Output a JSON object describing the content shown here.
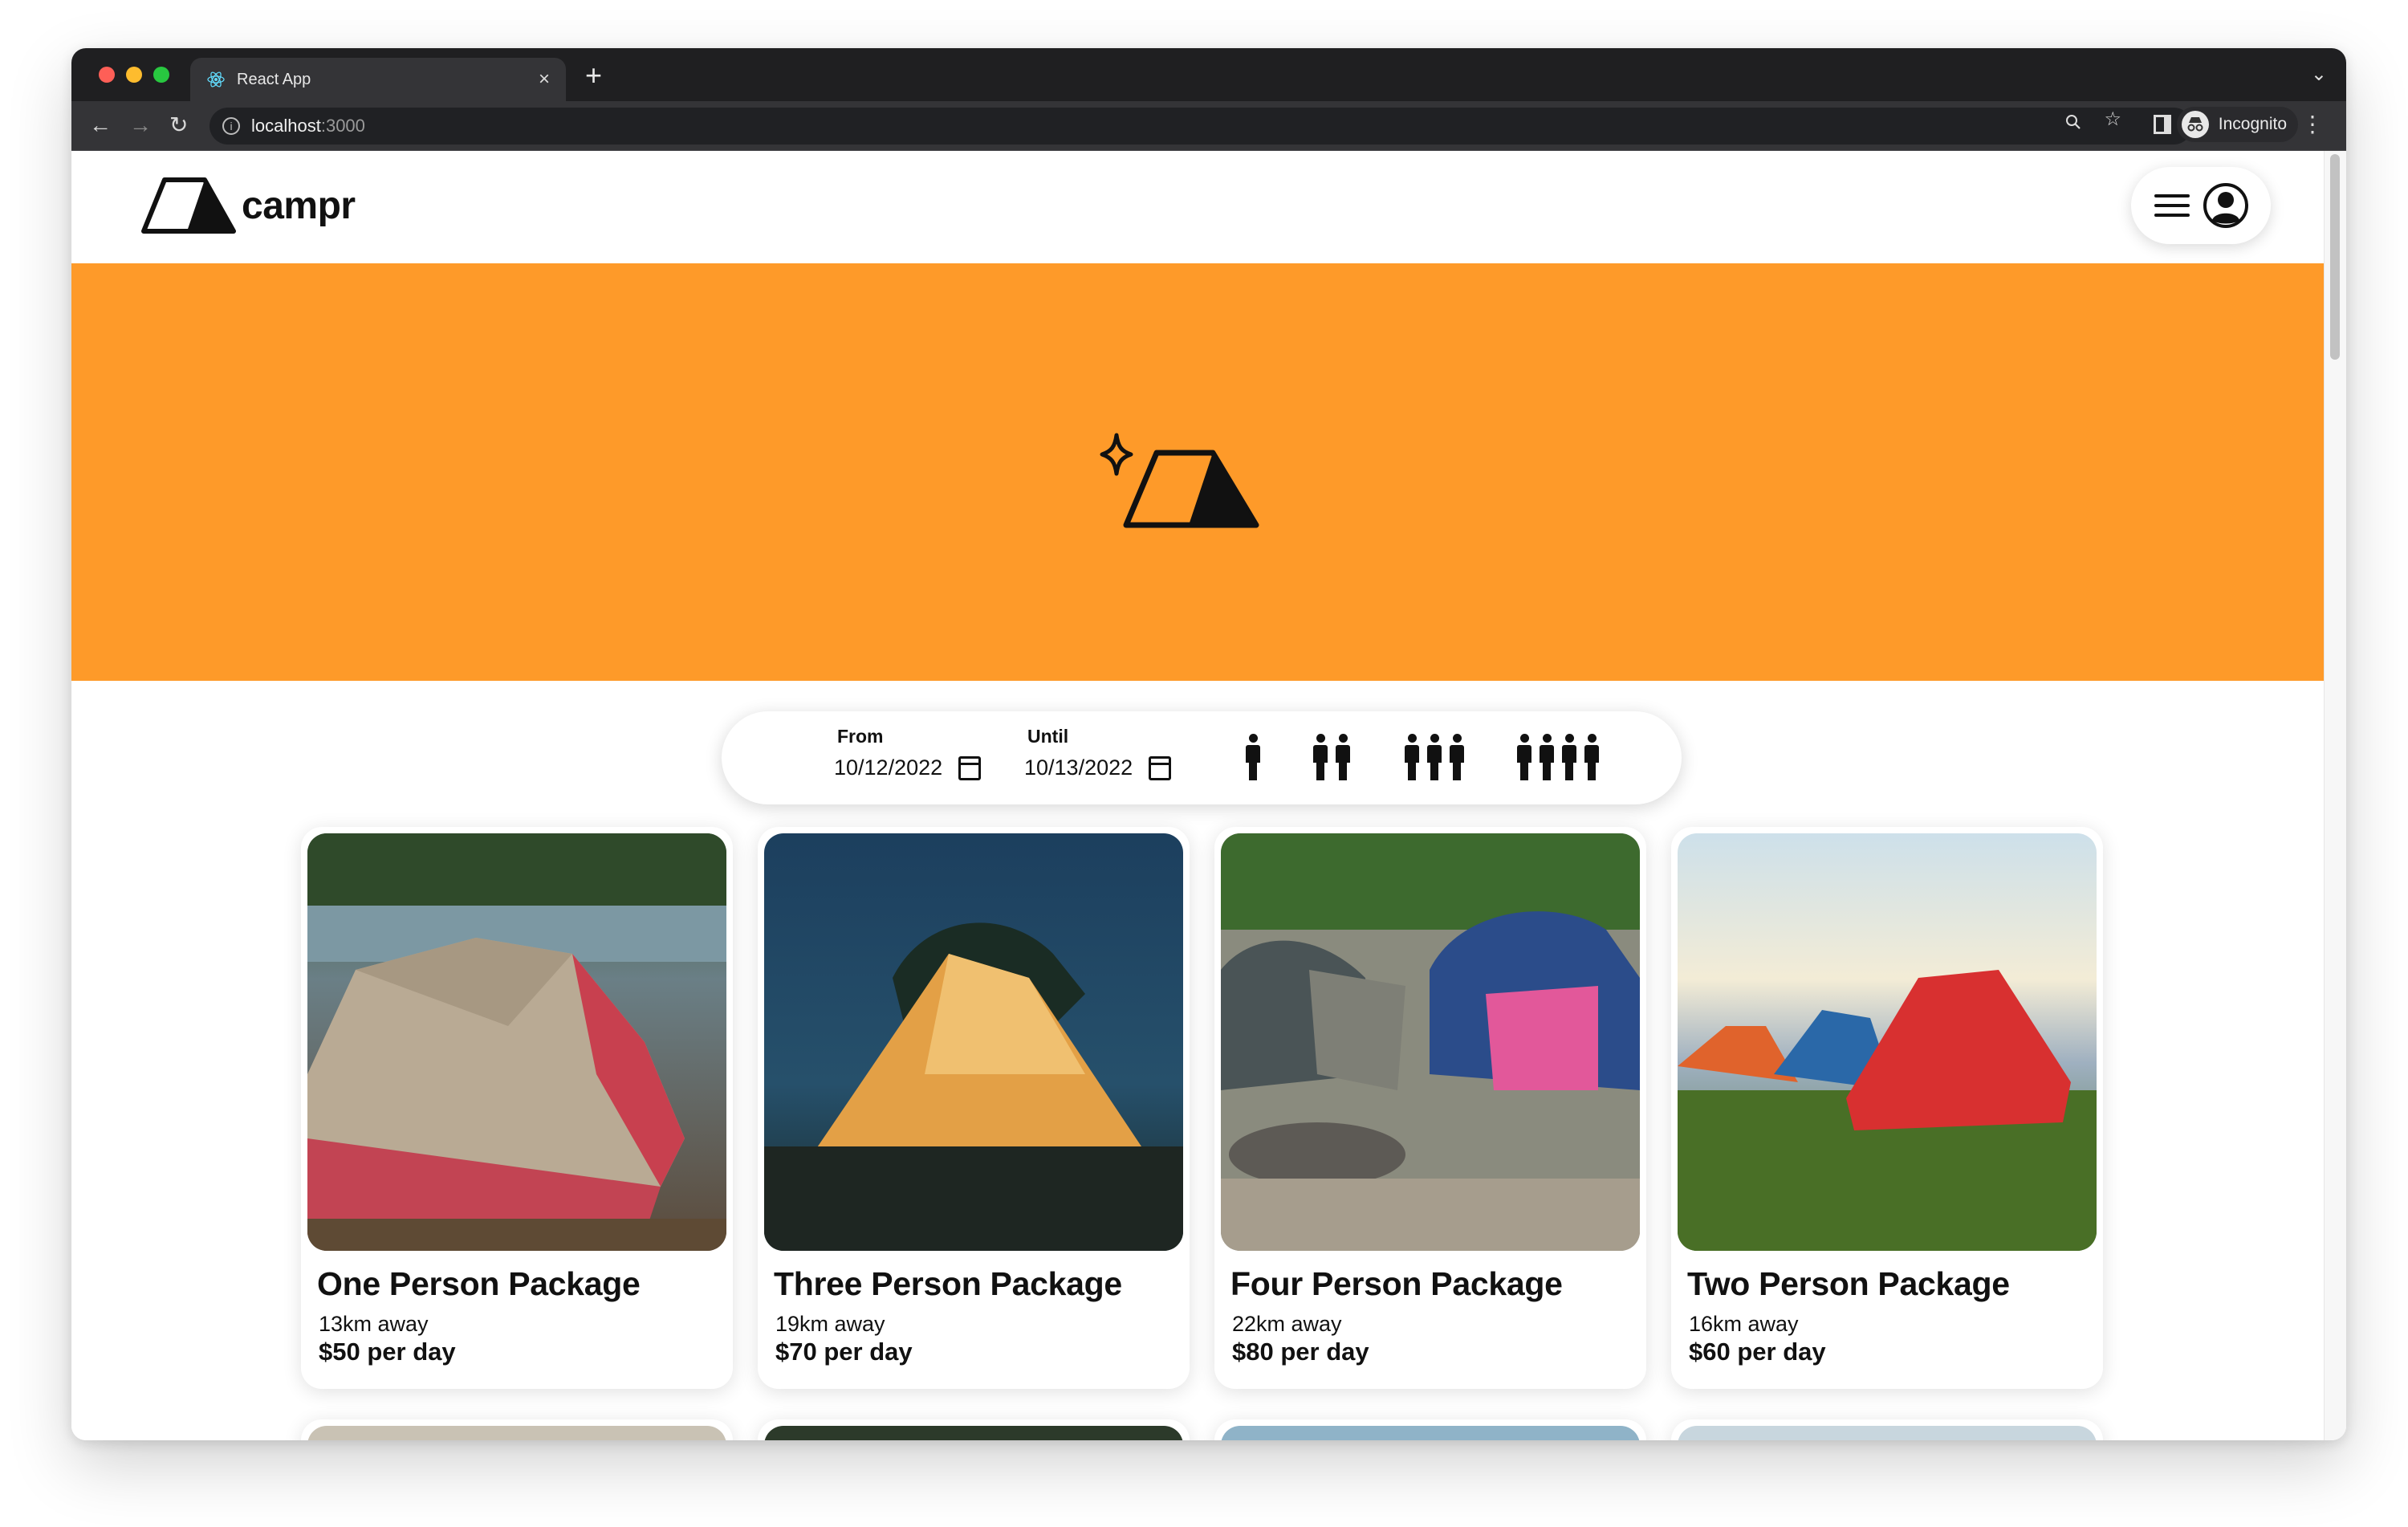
{
  "browser": {
    "tab_title": "React App",
    "url_host": "localhost",
    "url_port": ":3000",
    "profile_label": "Incognito",
    "new_tab_glyph": "+",
    "tab_close_glyph": "×"
  },
  "header": {
    "brand": "campr"
  },
  "filters": {
    "from_label": "From",
    "from_value": "10/12/2022",
    "until_label": "Until",
    "until_value": "10/13/2022",
    "party_sizes": [
      1,
      2,
      3,
      4
    ]
  },
  "packages": [
    {
      "title": "One Person Package",
      "distance": "13km away",
      "price": "$50 per day"
    },
    {
      "title": "Three Person Package",
      "distance": "19km away",
      "price": "$70 per day"
    },
    {
      "title": "Four Person Package",
      "distance": "22km away",
      "price": "$80 per day"
    },
    {
      "title": "Two Person Package",
      "distance": "16km away",
      "price": "$60 per day"
    }
  ],
  "colors": {
    "hero_orange": "#fe9a29",
    "titlebar": "#1f1f21",
    "toolbar": "#343437"
  }
}
